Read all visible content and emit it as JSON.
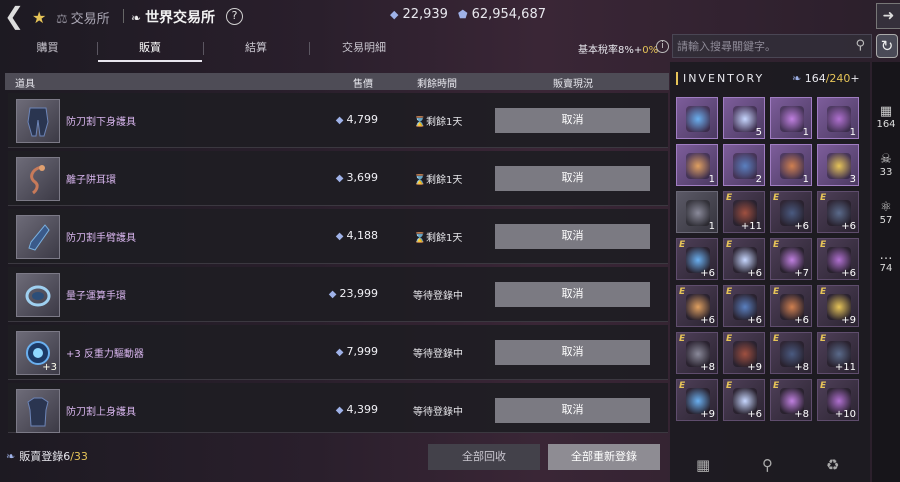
{
  "header": {
    "crumb_parent": "交易所",
    "title": "世界交易所",
    "help": "?",
    "currency1": "22,939",
    "currency2": "62,954,687"
  },
  "tabs": [
    {
      "label": "購買"
    },
    {
      "label": "販賣"
    },
    {
      "label": "結算"
    },
    {
      "label": "交易明細"
    }
  ],
  "tax": {
    "label": "基本稅率8%+",
    "value": "0%"
  },
  "search": {
    "placeholder": "請輸入搜尋關鍵字。"
  },
  "table": {
    "headers": {
      "item": "道具",
      "price": "售價",
      "remaining": "剩餘時間",
      "status": "販賣現況"
    },
    "cancel_label": "取消",
    "rows": [
      {
        "name": "防刀割下身護具",
        "price": "4,799",
        "remaining": "剩餘1天",
        "enh": ""
      },
      {
        "name": "離子阱耳環",
        "price": "3,699",
        "remaining": "剩餘1天",
        "enh": ""
      },
      {
        "name": "防刀割手臂護具",
        "price": "4,188",
        "remaining": "剩餘1天",
        "enh": ""
      },
      {
        "name": "量子運算手環",
        "price": "23,999",
        "remaining": "等待登錄中",
        "enh": ""
      },
      {
        "name": "+3 反重力驅動器",
        "price": "7,999",
        "remaining": "等待登錄中",
        "enh": "+3"
      },
      {
        "name": "防刀割上身護具",
        "price": "4,399",
        "remaining": "等待登錄中",
        "enh": ""
      }
    ]
  },
  "footer": {
    "registered_label": "販賣登錄",
    "registered": "6",
    "registered_max": "/33",
    "recall_all": "全部回收",
    "relist_all": "全部重新登錄"
  },
  "inventory": {
    "title": "INVENTORY",
    "count": "164",
    "max": "/240",
    "plus": "+",
    "slots": [
      {
        "style": "purple",
        "num": "",
        "e": ""
      },
      {
        "style": "purple",
        "num": "5",
        "e": ""
      },
      {
        "style": "purple",
        "num": "1",
        "e": ""
      },
      {
        "style": "purple",
        "num": "1",
        "e": ""
      },
      {
        "style": "purple",
        "num": "1",
        "e": ""
      },
      {
        "style": "purple",
        "num": "2",
        "e": ""
      },
      {
        "style": "purple",
        "num": "1",
        "e": ""
      },
      {
        "style": "purple",
        "num": "3",
        "e": ""
      },
      {
        "style": "gray",
        "num": "1",
        "e": ""
      },
      {
        "style": "dark",
        "num": "+11",
        "e": "E"
      },
      {
        "style": "dark",
        "num": "+6",
        "e": "E"
      },
      {
        "style": "dark",
        "num": "+6",
        "e": "E"
      },
      {
        "style": "dark",
        "num": "+6",
        "e": "E"
      },
      {
        "style": "dark",
        "num": "+6",
        "e": "E"
      },
      {
        "style": "dark",
        "num": "+7",
        "e": "E"
      },
      {
        "style": "dark",
        "num": "+6",
        "e": "E"
      },
      {
        "style": "dark",
        "num": "+6",
        "e": "E"
      },
      {
        "style": "dark",
        "num": "+6",
        "e": "E"
      },
      {
        "style": "dark",
        "num": "+6",
        "e": "E"
      },
      {
        "style": "dark",
        "num": "+9",
        "e": "E"
      },
      {
        "style": "dark",
        "num": "+8",
        "e": "E"
      },
      {
        "style": "dark",
        "num": "+9",
        "e": "E"
      },
      {
        "style": "dark",
        "num": "+8",
        "e": "E"
      },
      {
        "style": "dark",
        "num": "+11",
        "e": "E"
      },
      {
        "style": "dark",
        "num": "+9",
        "e": "E"
      },
      {
        "style": "dark",
        "num": "+6",
        "e": "E"
      },
      {
        "style": "dark",
        "num": "+8",
        "e": "E"
      },
      {
        "style": "dark",
        "num": "+10",
        "e": "E"
      }
    ]
  },
  "sidebar": [
    {
      "icon": "grid-icon",
      "count": "164"
    },
    {
      "icon": "equipment-icon",
      "count": "33"
    },
    {
      "icon": "potion-icon",
      "count": "57"
    },
    {
      "icon": "more-icon",
      "count": "74"
    }
  ],
  "colors": {
    "accent": "#e6c458",
    "item_name": "#d9b6ef",
    "cancel": "#7b7a82"
  }
}
